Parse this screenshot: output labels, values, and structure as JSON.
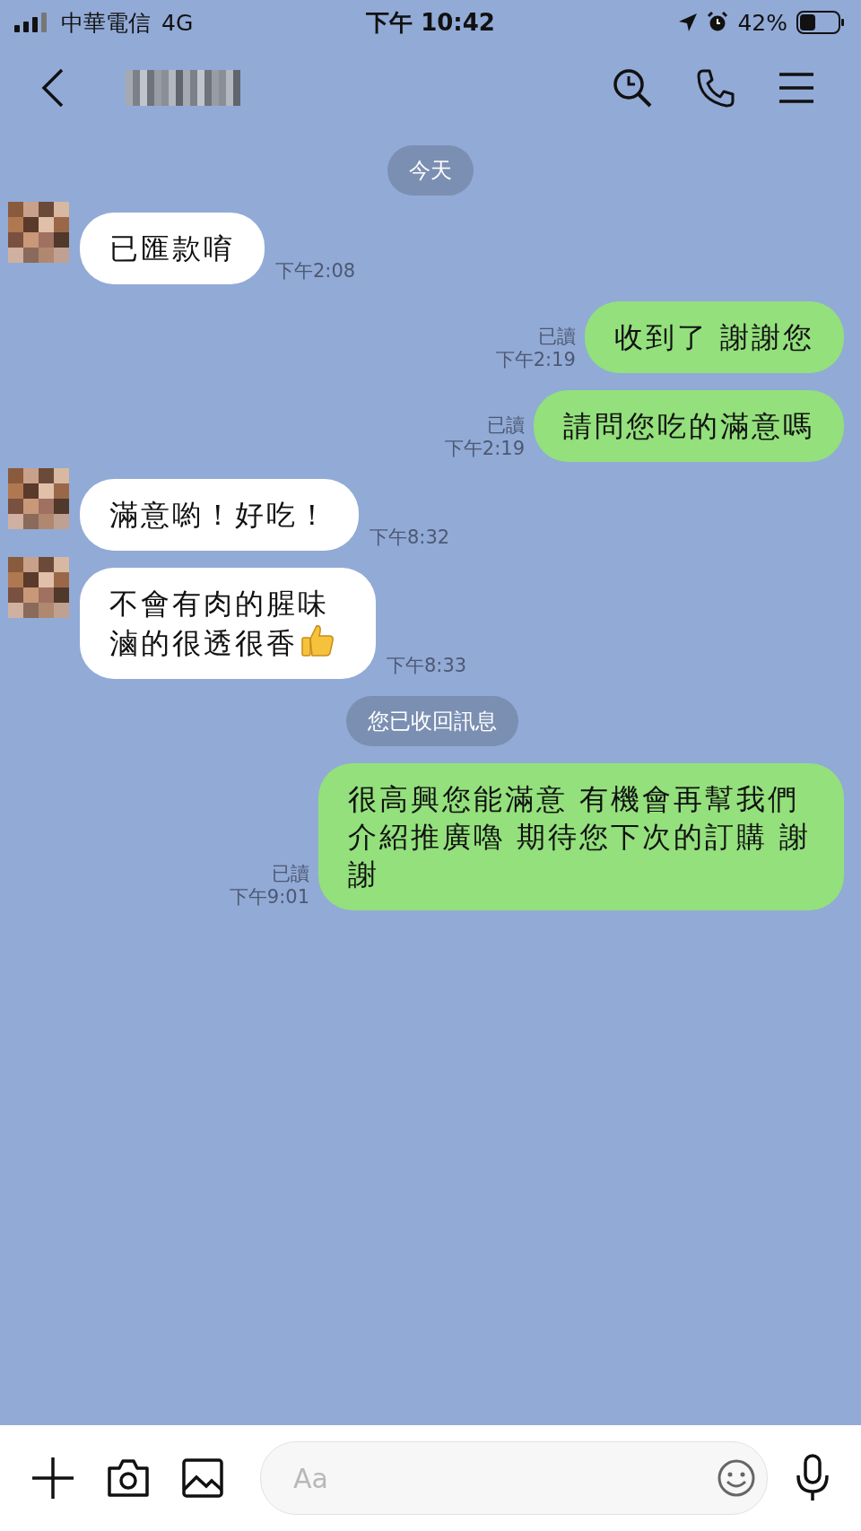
{
  "status_bar": {
    "carrier": "中華電信",
    "network": "4G",
    "time": "下午 10:42",
    "battery": "42%"
  },
  "date_separator": "今天",
  "messages": [
    {
      "kind": "incoming",
      "text": "已匯款唷",
      "time": "下午2:08"
    },
    {
      "kind": "outgoing",
      "text": "收到了 謝謝您",
      "read": "已讀",
      "time": "下午2:19"
    },
    {
      "kind": "outgoing",
      "text": "請問您吃的滿意嗎",
      "read": "已讀",
      "time": "下午2:19"
    },
    {
      "kind": "incoming",
      "text": "滿意喲！好吃！",
      "time": "下午8:32"
    },
    {
      "kind": "incoming",
      "text": "不會有肉的腥味滷的很透很香",
      "thumbs_up": true,
      "time": "下午8:33"
    },
    {
      "kind": "system",
      "text": "您已收回訊息"
    },
    {
      "kind": "outgoing",
      "text": "很高興您能滿意 有機會再幫我們介紹推廣嚕 期待您下次的訂購 謝謝",
      "read": "已讀",
      "time": "下午9:01"
    }
  ],
  "input": {
    "placeholder": "Aa"
  }
}
